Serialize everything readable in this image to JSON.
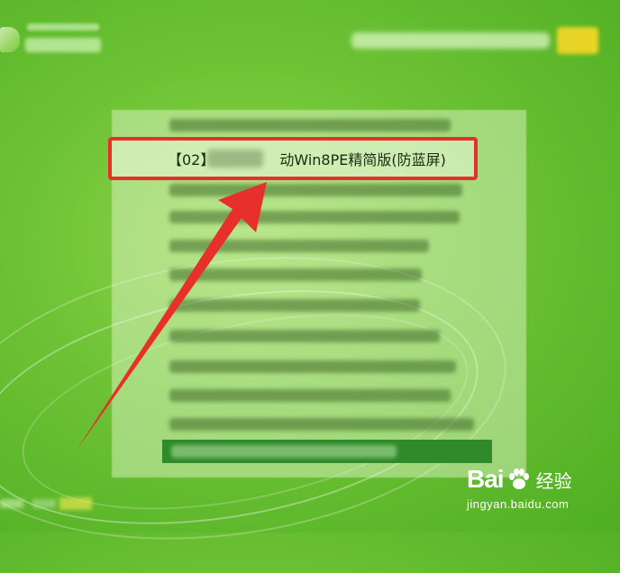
{
  "focus_item": {
    "label": "【02】　　　　　动Win8PE精简版(防蓝屏)"
  },
  "watermark": {
    "brand_latin": "Bai",
    "brand_cn": "经验",
    "url": "jingyan.baidu.com"
  },
  "colors": {
    "background": "#6cc234",
    "highlight_border": "#e8302a",
    "arrow": "#e8302a",
    "selected_item": "#2f8a2a",
    "badge": "#e8d426"
  },
  "icons": {
    "arrow": "arrow-icon",
    "paw": "paw-icon"
  }
}
